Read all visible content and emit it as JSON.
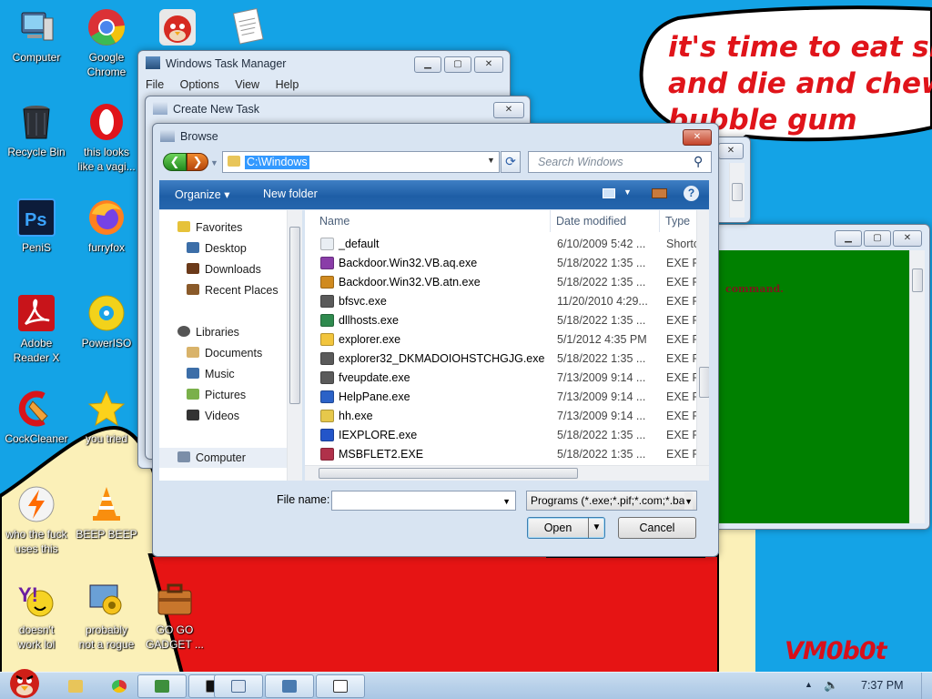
{
  "colors": {
    "desktop": "#14a3e6",
    "speech_text": "#e0141a",
    "green_console": "#008000",
    "selection": "#3399ff"
  },
  "desktop": {
    "speech_bubble_text": "it's time to eat shit\nand die and chew\nbubble gum",
    "signature": "VM0b0t",
    "icons": [
      {
        "label": "Computer",
        "icon": "computer-icon"
      },
      {
        "label": "Google\nChrome",
        "icon": "chrome-icon"
      },
      {
        "label": "",
        "icon": "angry-bird-icon"
      },
      {
        "label": "",
        "icon": "document-icon"
      },
      {
        "label": "Recycle Bin",
        "icon": "recycle-bin-icon"
      },
      {
        "label": "this looks\nlike a vagi...",
        "icon": "opera-icon"
      },
      {
        "label": "PeniS",
        "icon": "photoshop-icon"
      },
      {
        "label": "furryfox",
        "icon": "firefox-icon"
      },
      {
        "label": "Adobe\nReader X",
        "icon": "adobe-reader-icon"
      },
      {
        "label": "PowerISO",
        "icon": "poweriso-icon"
      },
      {
        "label": "CockCleaner",
        "icon": "ccleaner-icon"
      },
      {
        "label": "you tried",
        "icon": "star-icon"
      },
      {
        "label": "who the fuck\nuses this",
        "icon": "winamp-icon"
      },
      {
        "label": "BEEP BEEP",
        "icon": "vlc-icon"
      },
      {
        "label": "doesn't\nwork lol",
        "icon": "yahoo-messenger-icon"
      },
      {
        "label": "probably\nnot a rogue",
        "icon": "settings-app-icon"
      },
      {
        "label": "GO GO\nGADGET ...",
        "icon": "briefcase-icon"
      }
    ]
  },
  "task_manager": {
    "title": "Windows Task Manager",
    "menu": [
      "File",
      "Options",
      "View",
      "Help"
    ]
  },
  "create_task": {
    "title": "Create New Task"
  },
  "green_window": {
    "text": "command."
  },
  "browse": {
    "title": "Browse",
    "address": "C:\\Windows",
    "search_placeholder": "Search Windows",
    "toolbar": {
      "organize": "Organize ▾",
      "new_folder": "New folder"
    },
    "nav": [
      {
        "label": "Favorites",
        "icon": "star-icon",
        "kind": "group"
      },
      {
        "label": "Desktop",
        "icon": "desktop-folder-icon",
        "kind": "item"
      },
      {
        "label": "Downloads",
        "icon": "downloads-folder-icon",
        "kind": "item"
      },
      {
        "label": "Recent Places",
        "icon": "recent-places-icon",
        "kind": "item"
      },
      {
        "label": "Libraries",
        "icon": "libraries-icon",
        "kind": "group"
      },
      {
        "label": "Documents",
        "icon": "documents-folder-icon",
        "kind": "item"
      },
      {
        "label": "Music",
        "icon": "music-folder-icon",
        "kind": "item"
      },
      {
        "label": "Pictures",
        "icon": "pictures-folder-icon",
        "kind": "item"
      },
      {
        "label": "Videos",
        "icon": "videos-folder-icon",
        "kind": "item"
      },
      {
        "label": "Computer",
        "icon": "computer-icon",
        "kind": "group"
      }
    ],
    "columns": [
      "Name",
      "Date modified",
      "Type"
    ],
    "files": [
      {
        "name": "_default",
        "date": "6/10/2009 5:42 ...",
        "type": "Shortc",
        "icon": "shortcut-icon",
        "color": "#e9eef3"
      },
      {
        "name": "Backdoor.Win32.VB.aq.exe",
        "date": "5/18/2022 1:35 ...",
        "type": "EXE Fi",
        "icon": "exe-purple-icon",
        "color": "#8a3da8"
      },
      {
        "name": "Backdoor.Win32.VB.atn.exe",
        "date": "5/18/2022 1:35 ...",
        "type": "EXE Fi",
        "icon": "exe-globe-icon",
        "color": "#d08a1f"
      },
      {
        "name": "bfsvc.exe",
        "date": "11/20/2010 4:29...",
        "type": "EXE Fi",
        "icon": "exe-app-icon",
        "color": "#5a5a5a"
      },
      {
        "name": "dllhosts.exe",
        "date": "5/18/2022 1:35 ...",
        "type": "EXE Fi",
        "icon": "exe-network-icon",
        "color": "#2f8a4e"
      },
      {
        "name": "explorer.exe",
        "date": "5/1/2012 4:35 PM",
        "type": "EXE Fi",
        "icon": "folder-explorer-icon",
        "color": "#f2c53d"
      },
      {
        "name": "explorer32_DKMADOIOHSTCHGJG.exe",
        "date": "5/18/2022 1:35 ...",
        "type": "EXE Fi",
        "icon": "exe-app-icon",
        "color": "#5a5a5a"
      },
      {
        "name": "fveupdate.exe",
        "date": "7/13/2009 9:14 ...",
        "type": "EXE Fi",
        "icon": "exe-app-icon",
        "color": "#5a5a5a"
      },
      {
        "name": "HelpPane.exe",
        "date": "7/13/2009 9:14 ...",
        "type": "EXE Fi",
        "icon": "help-icon",
        "color": "#2b62c7"
      },
      {
        "name": "hh.exe",
        "date": "7/13/2009 9:14 ...",
        "type": "EXE Fi",
        "icon": "help-file-icon",
        "color": "#e6c84b"
      },
      {
        "name": "IEXPLORE.exe",
        "date": "5/18/2022 1:35 ...",
        "type": "EXE Fi",
        "icon": "internet-explorer-icon",
        "color": "#2355c9"
      },
      {
        "name": "MSBFLET2.EXE",
        "date": "5/18/2022 1:35 ...",
        "type": "EXE Fi",
        "icon": "exe-book-icon",
        "color": "#b0314a"
      }
    ],
    "file_name_label": "File name:",
    "file_name_value": "",
    "filter": "Programs (*.exe;*.pif;*.com;*.ba",
    "open": "Open",
    "cancel": "Cancel"
  },
  "taskbar": {
    "clock": "7:37 PM",
    "buttons": [
      {
        "icon": "explorer-folder-icon"
      },
      {
        "icon": "chrome-icon"
      },
      {
        "icon": "recycle-arrow-icon"
      },
      {
        "icon": "cmd-icon"
      },
      {
        "icon": "run-dialog-icon"
      },
      {
        "icon": "task-manager-icon"
      },
      {
        "icon": "window-icon"
      }
    ]
  }
}
